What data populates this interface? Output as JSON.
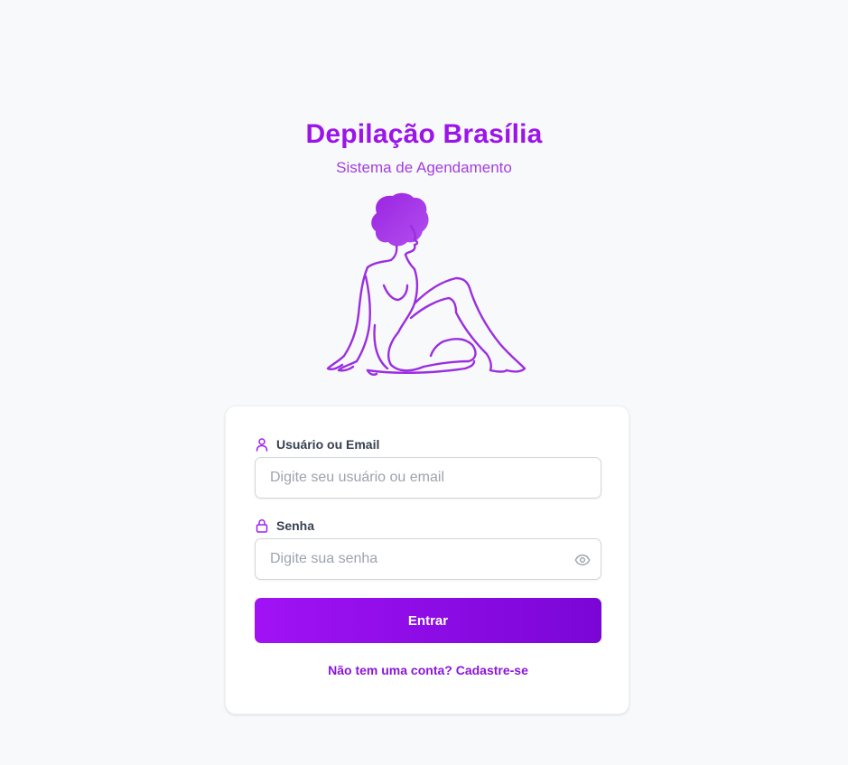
{
  "brand": {
    "title": "Depilação Brasília",
    "subtitle": "Sistema de Agendamento",
    "illustration": "seated-woman-line-art"
  },
  "login": {
    "username_label": "Usuário ou Email",
    "username_icon": "user-icon",
    "username_placeholder": "Digite seu usuário ou email",
    "username_value": "",
    "password_label": "Senha",
    "password_icon": "lock-icon",
    "password_placeholder": "Digite sua senha",
    "password_value": "",
    "toggle_icon": "eye-icon",
    "submit_label": "Entrar",
    "signup_text": "Não tem uma conta? Cadastre-se"
  },
  "colors": {
    "accent": "#9b14e8",
    "button_start": "#a012f5",
    "button_end": "#7a06d6",
    "background": "#f8f9fb"
  }
}
